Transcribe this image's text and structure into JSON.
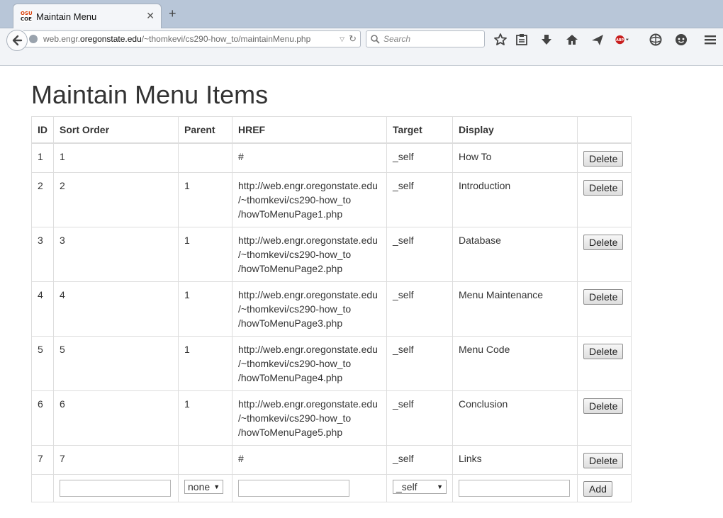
{
  "browser": {
    "tab_title": "Maintain Menu",
    "tab_logo_top": "OSU",
    "tab_logo_bottom": "COE",
    "url_prefix": "web.engr.",
    "url_domain": "oregonstate.edu",
    "url_path": "/~thomkevi/cs290-how_to/maintainMenu.php",
    "search_placeholder": "Search",
    "toolbar_icons": [
      "star-icon",
      "reading-list-icon",
      "download-icon",
      "home-icon",
      "send-icon",
      "adblock-icon",
      "addon-icon",
      "chat-icon",
      "menu-icon"
    ]
  },
  "page": {
    "title": "Maintain Menu Items",
    "columns": [
      "ID",
      "Sort Order",
      "Parent",
      "HREF",
      "Target",
      "Display"
    ],
    "rows": [
      {
        "id": "1",
        "sort": "1",
        "parent": "",
        "href": [
          "#"
        ],
        "target": "_self",
        "display": "How To",
        "action": "Delete"
      },
      {
        "id": "2",
        "sort": "2",
        "parent": "1",
        "href": [
          "http://web.engr.oregonstate.edu",
          "/~thomkevi/cs290-how_to",
          "/howToMenuPage1.php"
        ],
        "target": "_self",
        "display": "Introduction",
        "action": "Delete"
      },
      {
        "id": "3",
        "sort": "3",
        "parent": "1",
        "href": [
          "http://web.engr.oregonstate.edu",
          "/~thomkevi/cs290-how_to",
          "/howToMenuPage2.php"
        ],
        "target": "_self",
        "display": "Database",
        "action": "Delete"
      },
      {
        "id": "4",
        "sort": "4",
        "parent": "1",
        "href": [
          "http://web.engr.oregonstate.edu",
          "/~thomkevi/cs290-how_to",
          "/howToMenuPage3.php"
        ],
        "target": "_self",
        "display": "Menu Maintenance",
        "action": "Delete"
      },
      {
        "id": "5",
        "sort": "5",
        "parent": "1",
        "href": [
          "http://web.engr.oregonstate.edu",
          "/~thomkevi/cs290-how_to",
          "/howToMenuPage4.php"
        ],
        "target": "_self",
        "display": "Menu Code",
        "action": "Delete"
      },
      {
        "id": "6",
        "sort": "6",
        "parent": "1",
        "href": [
          "http://web.engr.oregonstate.edu",
          "/~thomkevi/cs290-how_to",
          "/howToMenuPage5.php"
        ],
        "target": "_self",
        "display": "Conclusion",
        "action": "Delete"
      },
      {
        "id": "7",
        "sort": "7",
        "parent": "",
        "href": [
          "#"
        ],
        "target": "_self",
        "display": "Links",
        "action": "Delete"
      }
    ],
    "add_row": {
      "sort_value": "",
      "parent_selected": "none",
      "href_value": "",
      "target_selected": "_self",
      "display_value": "",
      "add_label": "Add"
    }
  }
}
